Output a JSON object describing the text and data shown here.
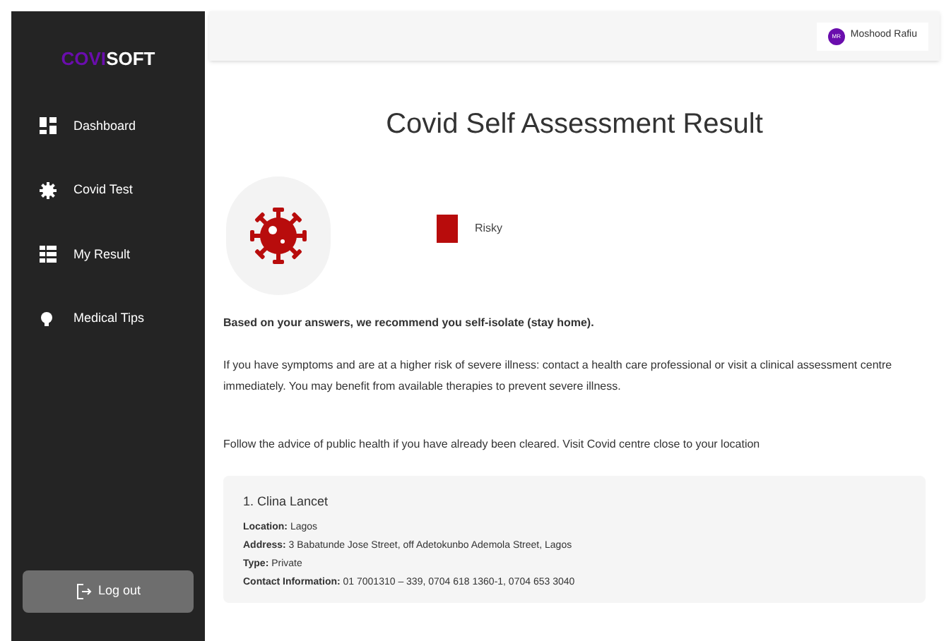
{
  "logo": {
    "first": "COVI",
    "second": "SOFT"
  },
  "sidebar": {
    "items": [
      {
        "label": "Dashboard",
        "selected": false
      },
      {
        "label": "Covid Test",
        "selected": false
      },
      {
        "label": "My Result",
        "selected": false
      },
      {
        "label": "Medical Tips",
        "selected": false
      }
    ],
    "logout": "Log out"
  },
  "header": {
    "user": {
      "initials": "MR",
      "name": "Moshood Rafiu"
    }
  },
  "title": "Covid Self Assessment Result",
  "result": {
    "label": "Risky",
    "color": "#b80c0c"
  },
  "recommendation": "Based on your answers, we recommend you self-isolate (stay home).",
  "advice": "If you have symptoms and are at a higher risk of severe illness: contact a health care professional or visit a clinical assessment centre immediately. You may benefit from available therapies to prevent severe illness.",
  "follow": "Follow the advice of public health if you have already been cleared. Visit Covid centre close to your location",
  "centres": [
    {
      "name": "1. Clina Lancet",
      "lines": [
        "**Location:** Lagos",
        "**Address:** 3 Babatunde Jose Street, off Adetokunbo Ademola Street, Lagos",
        "**Type:** Private",
        "**Contact Information:** 01 7001310 – 339, 0704 618 1360-1, 0704 653 3040"
      ]
    }
  ]
}
